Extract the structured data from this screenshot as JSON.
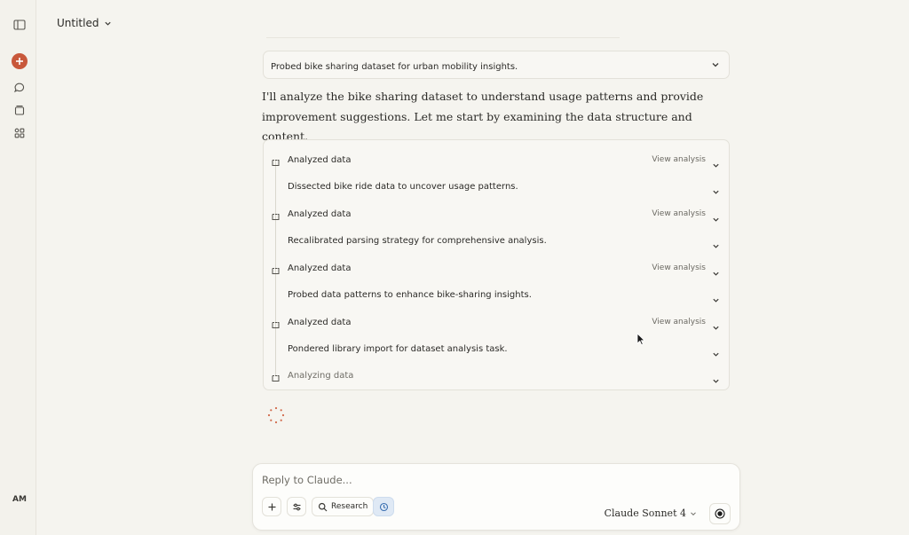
{
  "header": {
    "title": "Untitled"
  },
  "sidebar": {
    "icons": [
      "sidebar-toggle-icon",
      "new-chat-icon",
      "chats-icon",
      "projects-icon",
      "artifacts-icon"
    ],
    "user_initials": "AM"
  },
  "conversation": {
    "thought_summary": "Probed bike sharing dataset for urban mobility insights.",
    "intro_text": "I'll analyze the bike sharing dataset to understand usage patterns and provide improvement suggestions. Let me start by examining the data structure and content.",
    "steps": [
      {
        "label": "Analyzed data",
        "action": "View analysis",
        "kind": "tool"
      },
      {
        "label": "Dissected bike ride data to uncover usage patterns.",
        "action": "",
        "kind": "thought"
      },
      {
        "label": "Analyzed data",
        "action": "View analysis",
        "kind": "tool"
      },
      {
        "label": "Recalibrated parsing strategy for comprehensive analysis.",
        "action": "",
        "kind": "thought"
      },
      {
        "label": "Analyzed data",
        "action": "View analysis",
        "kind": "tool"
      },
      {
        "label": "Probed data patterns to enhance bike-sharing insights.",
        "action": "",
        "kind": "thought"
      },
      {
        "label": "Analyzed data",
        "action": "View analysis",
        "kind": "tool"
      },
      {
        "label": "Pondered library import for dataset analysis task.",
        "action": "",
        "kind": "thought"
      },
      {
        "label": "Analyzing data",
        "action": "",
        "kind": "tool-pending"
      }
    ]
  },
  "composer": {
    "placeholder": "Reply to Claude...",
    "research_label": "Research",
    "model_label": "Claude Sonnet 4"
  },
  "colors": {
    "accent": "#c8583b",
    "background": "#f5f4ef",
    "active_tool": "#dfe9f5"
  }
}
